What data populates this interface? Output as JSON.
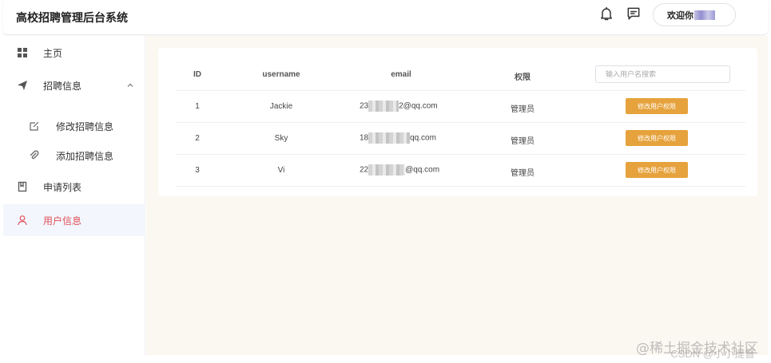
{
  "header": {
    "title": "高校招聘管理后台系统",
    "welcome_label": "欢迎你"
  },
  "sidebar": {
    "items": [
      {
        "label": "主页",
        "icon": "grid-icon"
      },
      {
        "label": "招聘信息",
        "icon": "send-icon",
        "expanded": true
      },
      {
        "label": "修改招聘信息",
        "icon": "edit-icon"
      },
      {
        "label": "添加招聘信息",
        "icon": "paperclip-icon"
      },
      {
        "label": "申请列表",
        "icon": "book-icon"
      },
      {
        "label": "用户信息",
        "icon": "user-icon",
        "active": true
      }
    ]
  },
  "table": {
    "columns": [
      "ID",
      "username",
      "email",
      "权限"
    ],
    "search_placeholder": "输入用户名搜索",
    "action_label": "修改用户权限",
    "rows": [
      {
        "id": "1",
        "username": "Jackie",
        "email_prefix": "23",
        "email_suffix": "2@qq.com",
        "role": "管理员"
      },
      {
        "id": "2",
        "username": "Sky",
        "email_prefix": "18",
        "email_suffix": "qq.com",
        "role": "管理员"
      },
      {
        "id": "3",
        "username": "Vi",
        "email_prefix": "22",
        "email_suffix": "@qq.com",
        "role": "管理员"
      }
    ]
  },
  "watermark": "@稀土掘金技术社区",
  "watermark_sub": "CSDN @小小提督",
  "colors": {
    "accent_button": "#e6a23c",
    "active_text": "#e2505a",
    "main_bg": "#fbf7f1"
  }
}
